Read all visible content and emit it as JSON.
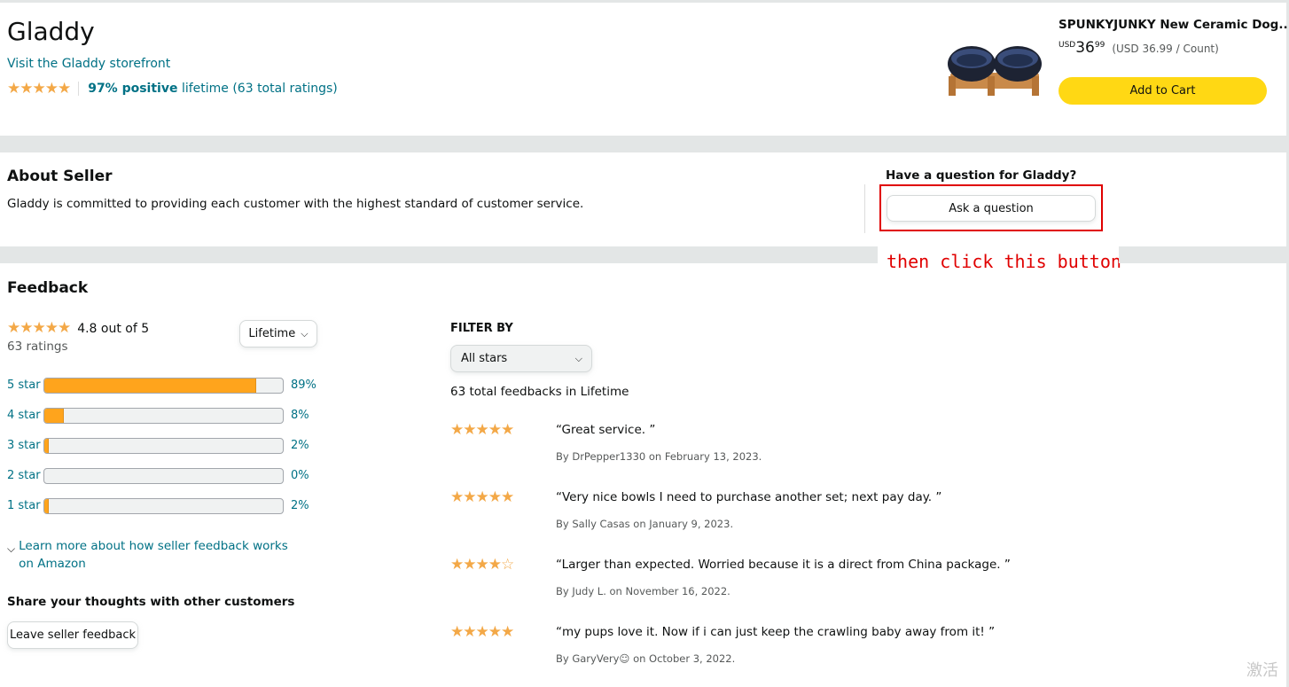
{
  "seller": {
    "name": "Gladdy",
    "storefront_link": "Visit the Gladdy storefront",
    "positive_pct": "97% positive",
    "positive_rest": "lifetime (63 total ratings)",
    "rating_stars": 5
  },
  "product": {
    "title": "SPUNKYJUNKY New Ceramic Dog...",
    "currency": "USD",
    "price_whole": "36",
    "price_fraction": "99",
    "unit_price": "(USD 36.99 / Count)",
    "add_to_cart_label": "Add to Cart"
  },
  "about": {
    "heading": "About Seller",
    "description": "Gladdy is committed to providing each customer with the highest standard of customer service.",
    "question_heading": "Have a question for Gladdy?",
    "ask_button_label": "Ask a question",
    "annotation_text": "then click this button",
    "annotation_color": "#e00000"
  },
  "feedback": {
    "heading": "Feedback",
    "average_text": "4.8 out of  5",
    "ratings_count": "63 ratings",
    "period_selected": "Lifetime",
    "histogram": [
      {
        "label": "5 star",
        "percent_label": "89%",
        "fraction": 0.89
      },
      {
        "label": "4 star",
        "percent_label": "8%",
        "fraction": 0.08
      },
      {
        "label": "3 star",
        "percent_label": "2%",
        "fraction": 0.02
      },
      {
        "label": "2 star",
        "percent_label": "0%",
        "fraction": 0.0
      },
      {
        "label": "1 star",
        "percent_label": "2%",
        "fraction": 0.02
      }
    ],
    "learn_more": "Learn more about how seller feedback works on Amazon",
    "share_heading": "Share your thoughts with other customers",
    "leave_feedback_label": "Leave seller feedback",
    "filter_by_label": "FILTER BY",
    "filter_selected": "All stars",
    "total_text": "63 total feedbacks in Lifetime",
    "reviews": [
      {
        "stars": 5,
        "quote": "“Great service. ”",
        "byline": "By DrPepper1330 on February 13, 2023."
      },
      {
        "stars": 5,
        "quote": "“Very nice bowls I need to purchase another set; next pay day. ”",
        "byline": "By Sally Casas on January 9, 2023."
      },
      {
        "stars": 4,
        "quote": "“Larger than expected. Worried because it is a direct from China package. ”",
        "byline": "By Judy L. on November 16, 2022."
      },
      {
        "stars": 5,
        "quote": "“my pups love it. Now if i can just keep the crawling baby away from it! ”",
        "byline": "By GaryVery☺ on October 3, 2022."
      }
    ]
  },
  "watermark": "激活",
  "colors": {
    "link": "#007185",
    "star": "#f3a847",
    "bar_fill": "#ffa41c",
    "cart_button": "#ffd814",
    "band": "#e3e6e6"
  }
}
